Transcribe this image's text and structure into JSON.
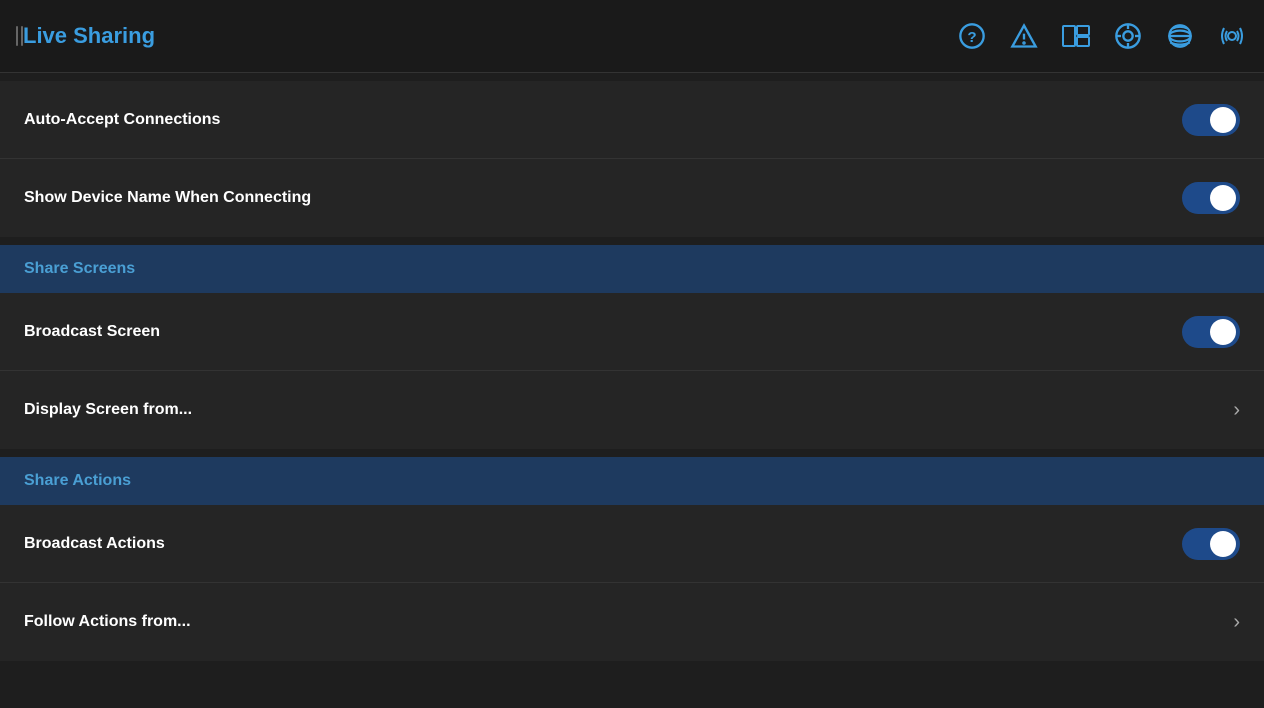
{
  "header": {
    "drag_handle": "||",
    "title": "Live Sharing",
    "icons": [
      {
        "name": "help-icon",
        "label": "?"
      },
      {
        "name": "warning-icon",
        "label": "⚠"
      },
      {
        "name": "keyboard-icon",
        "label": "⌨"
      },
      {
        "name": "settings-icon",
        "label": "⚙"
      },
      {
        "name": "remote-icon",
        "label": "📡"
      },
      {
        "name": "wave-icon",
        "label": "〰"
      }
    ]
  },
  "settings": {
    "top_group": [
      {
        "id": "auto-accept",
        "label": "Auto-Accept Connections",
        "type": "toggle",
        "value": true
      },
      {
        "id": "show-device-name",
        "label": "Show Device Name When Connecting",
        "type": "toggle",
        "value": true
      }
    ],
    "share_screens": {
      "section_label": "Share Screens",
      "items": [
        {
          "id": "broadcast-screen",
          "label": "Broadcast Screen",
          "type": "toggle",
          "value": true
        },
        {
          "id": "display-screen",
          "label": "Display Screen from...",
          "type": "nav"
        }
      ]
    },
    "share_actions": {
      "section_label": "Share Actions",
      "items": [
        {
          "id": "broadcast-actions",
          "label": "Broadcast Actions",
          "type": "toggle",
          "value": true
        },
        {
          "id": "follow-actions",
          "label": "Follow Actions from...",
          "type": "nav"
        }
      ]
    }
  }
}
